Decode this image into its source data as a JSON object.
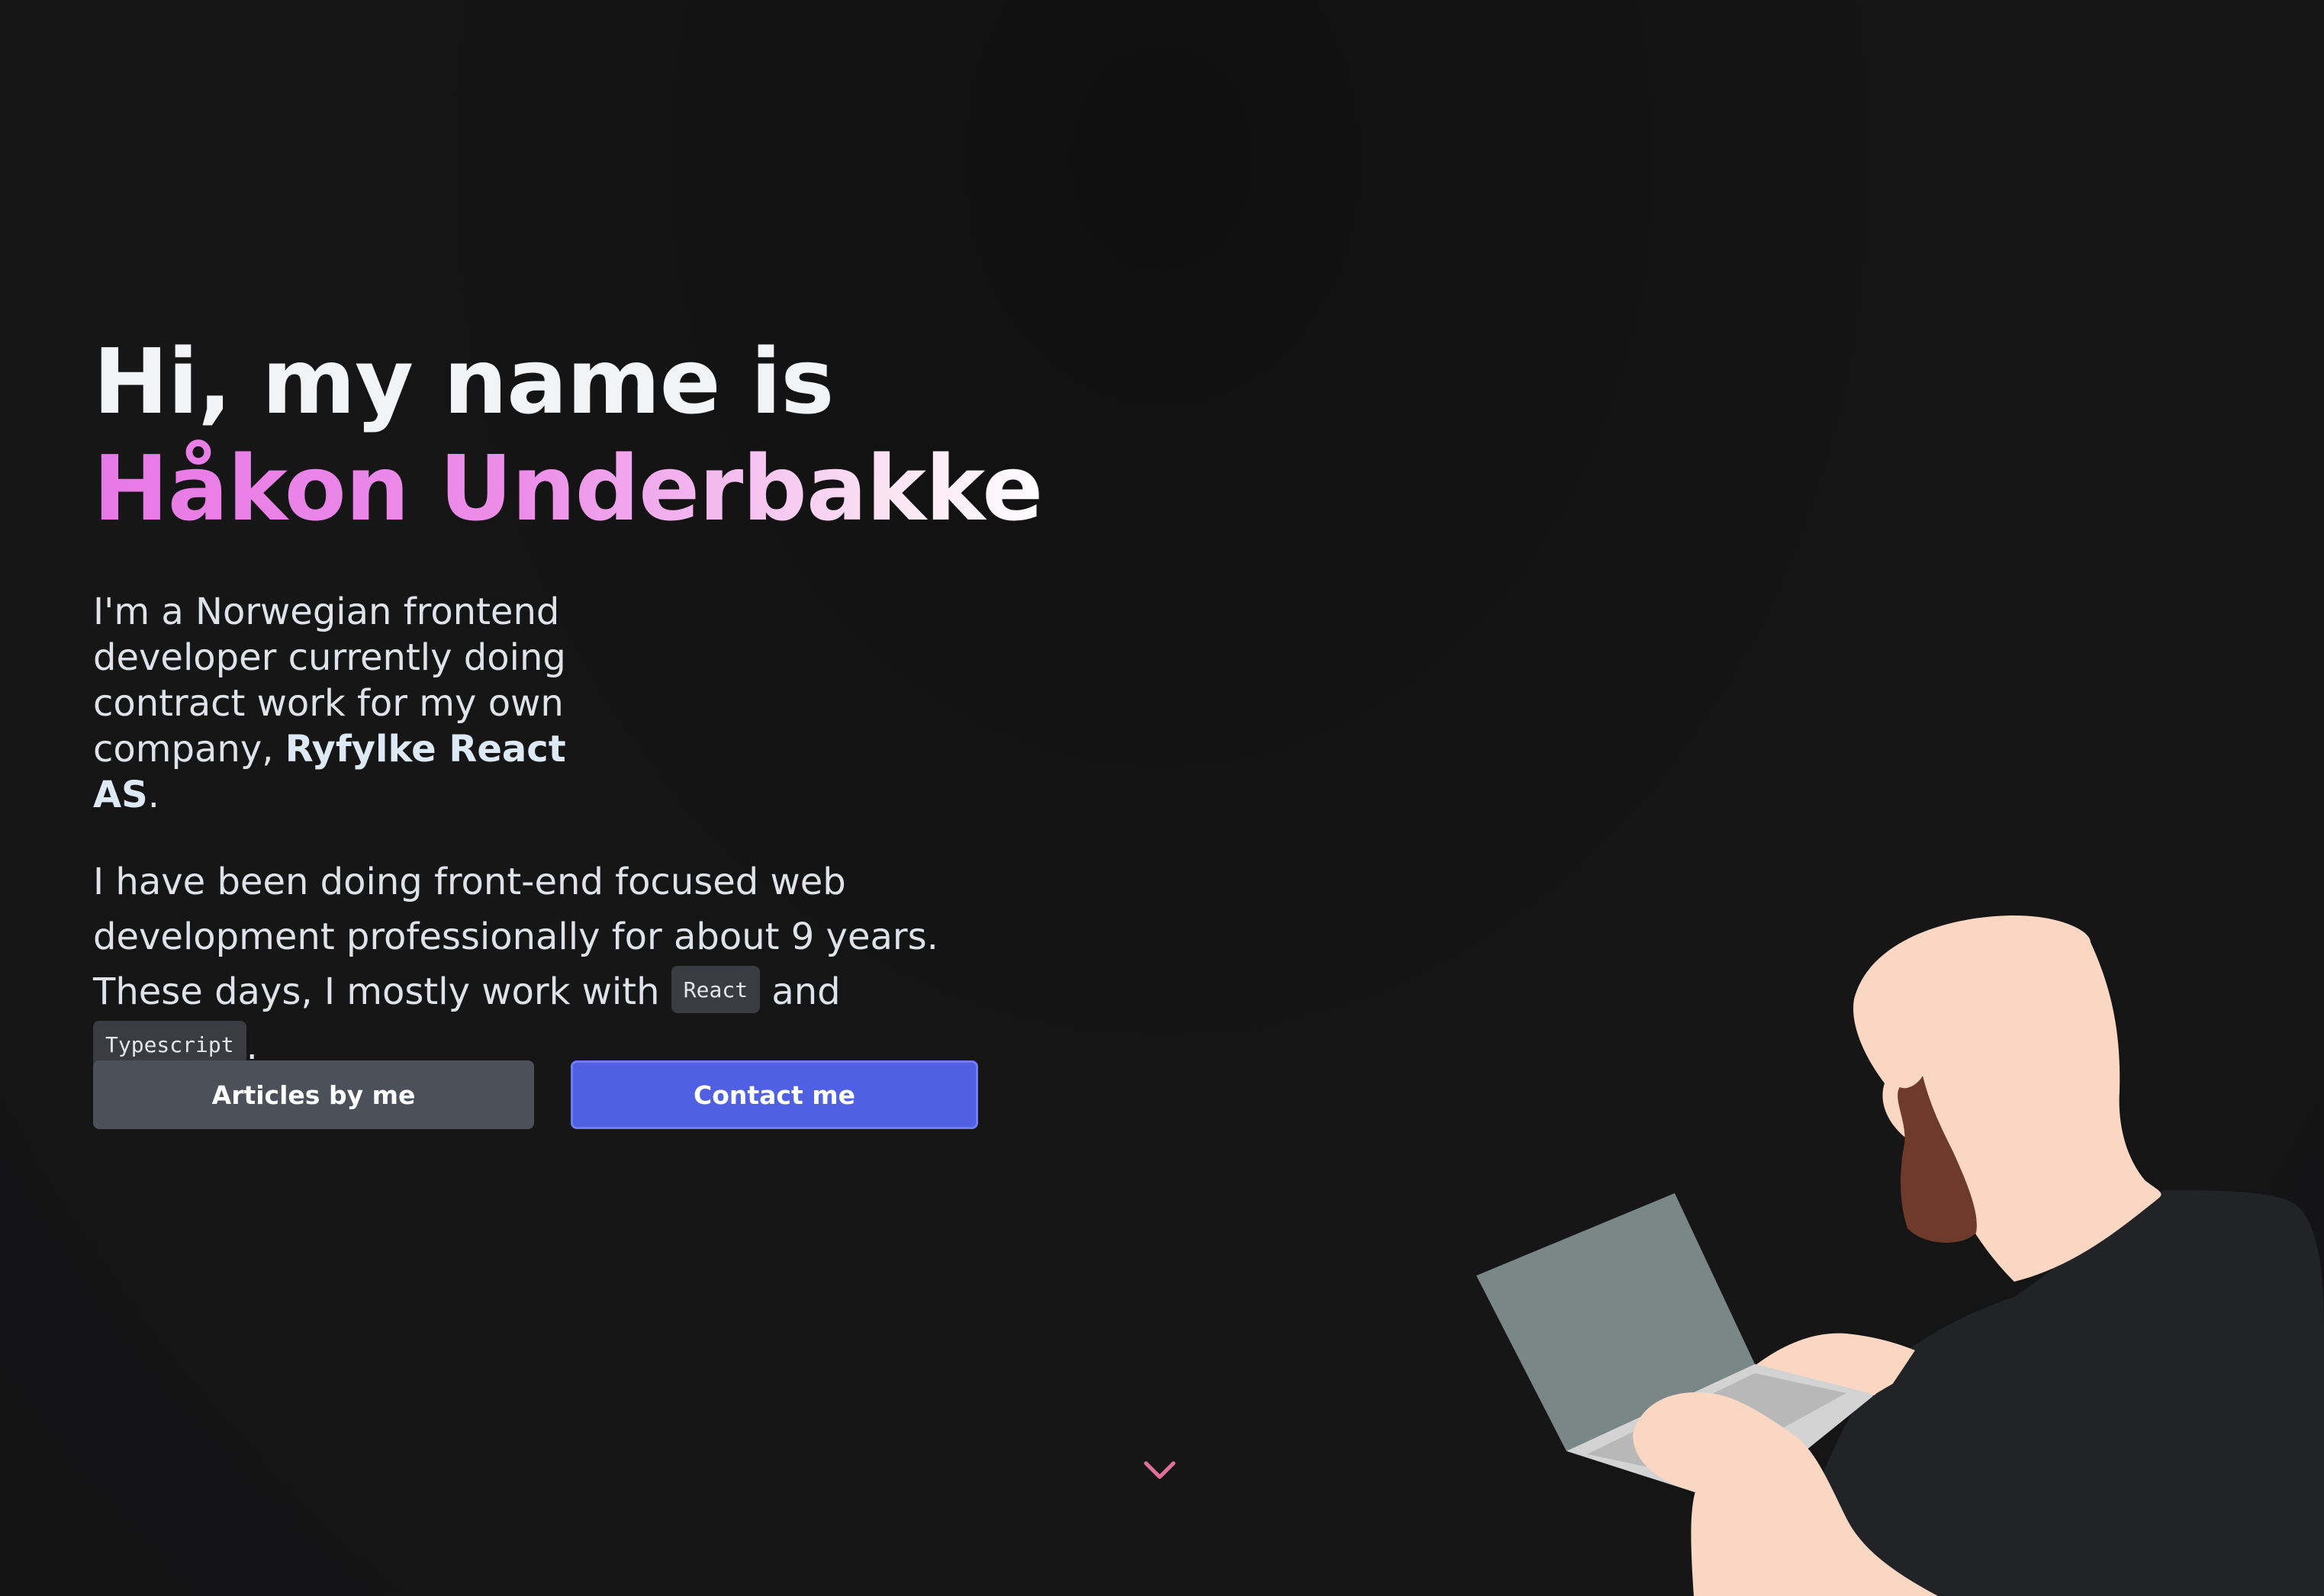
{
  "hero": {
    "greeting": "Hi, my name is",
    "name": "Håkon Underbakke",
    "intro_prefix": "I'm a Norwegian frontend developer currently doing contract work for my own company, ",
    "intro_company": "Ryfylke React AS",
    "intro_suffix": ".",
    "about_prefix": "I have been doing front-end focused web development professionally for about 9 years. These days, I mostly work with ",
    "tech_1": "React",
    "about_middle": " and ",
    "tech_2": "Typescript",
    "about_suffix": "."
  },
  "buttons": {
    "articles_label": "Articles by me",
    "contact_label": "Contact me"
  },
  "icons": {
    "scroll": "chevron-down-icon",
    "illustration": "developer-with-laptop-illustration"
  },
  "colors": {
    "background": "#141415",
    "name_gradient_start": "#e879e6",
    "name_gradient_end": "#ffffff",
    "articles_button": "#4c5059",
    "contact_button": "#4f60e2",
    "chevron": "#e0709a"
  }
}
